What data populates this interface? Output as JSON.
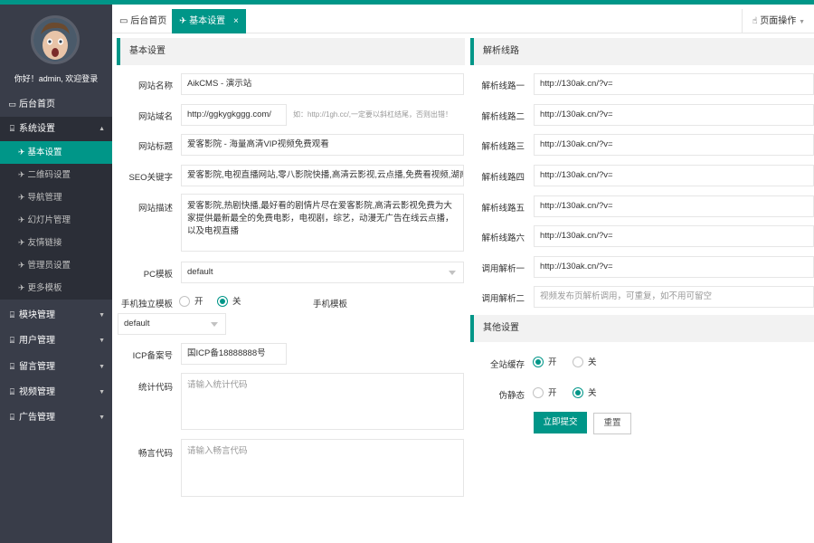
{
  "sidebar": {
    "greeting": "你好！admin, 欢迎登录",
    "items": [
      {
        "label": "后台首页",
        "icon": "monitor-icon"
      },
      {
        "label": "系统设置",
        "icon": "settings-icon"
      },
      {
        "label": "模块管理"
      },
      {
        "label": "用户管理"
      },
      {
        "label": "留言管理"
      },
      {
        "label": "视频管理"
      },
      {
        "label": "广告管理"
      }
    ],
    "subitems": [
      {
        "label": "基本设置"
      },
      {
        "label": "二维码设置"
      },
      {
        "label": "导航管理"
      },
      {
        "label": "幻灯片管理"
      },
      {
        "label": "友情链接"
      },
      {
        "label": "管理员设置"
      },
      {
        "label": "更多模板"
      }
    ]
  },
  "tabs": [
    {
      "label": "后台首页",
      "icon": "monitor-icon"
    },
    {
      "label": "基本设置",
      "icon": "send-icon",
      "close": "×"
    }
  ],
  "page_op": "页面操作",
  "basic": {
    "title": "基本设置",
    "site_name_label": "网站名称",
    "site_name_value": "AikCMS - 演示站",
    "domain_label": "网站域名",
    "domain_value": "http://ɡɡkyɡkɡɡɡ.com/",
    "domain_hint": "如：http://1gh.cc/,一定要以斜杠结尾，否则出错！",
    "site_title_label": "网站标题",
    "site_title_value": "爱客影院 - 海量高清VIP视频免费观看",
    "seo_label": "SEO关键字",
    "seo_value": "爱客影院,电视直播网站,零八影院快播,高清云影视,云点播,免费看视频,湖南卫视",
    "desc_label": "网站描述",
    "desc_value": "爱客影院,热剧快播,最好看的剧情片尽在爱客影院,高清云影视免费为大家提供最新最全的免费电影，电视剧，综艺，动漫无广告在线云点播，以及电视直播",
    "pc_tpl_label": "PC模板",
    "pc_tpl_value": "default",
    "mobile_indep_label": "手机独立模板",
    "open": "开",
    "close": "关",
    "mobile_tpl_label": "手机模板",
    "mobile_tpl_value": "default",
    "icp_label": "ICP备案号",
    "icp_value": "国ICP备18888888号",
    "stat_label": "统计代码",
    "stat_placeholder": "请输入统计代码",
    "changyan_label": "畅言代码",
    "changyan_placeholder": "请输入畅言代码"
  },
  "parse": {
    "title": "解析线路",
    "lines": [
      {
        "label": "解析线路一",
        "value": "http://130ak.cn/?v="
      },
      {
        "label": "解析线路二",
        "value": "http://130ak.cn/?v="
      },
      {
        "label": "解析线路三",
        "value": "http://130ak.cn/?v="
      },
      {
        "label": "解析线路四",
        "value": "http://130ak.cn/?v="
      },
      {
        "label": "解析线路五",
        "value": "http://130ak.cn/?v="
      },
      {
        "label": "解析线路六",
        "value": "http://130ak.cn/?v="
      },
      {
        "label": "调用解析一",
        "value": "http://130ak.cn/?v="
      }
    ],
    "call2_label": "调用解析二",
    "call2_placeholder": "视频发布页解析调用，可重复，如不用可留空"
  },
  "other": {
    "title": "其他设置",
    "cache_label": "全站缓存",
    "pseudo_label": "伪静态",
    "open": "开",
    "close": "关",
    "submit": "立即提交",
    "reset": "重置"
  },
  "colors": {
    "accent": "#009688",
    "sidebar_bg": "#393d49",
    "sidebar_sub_bg": "#2b2e37"
  }
}
